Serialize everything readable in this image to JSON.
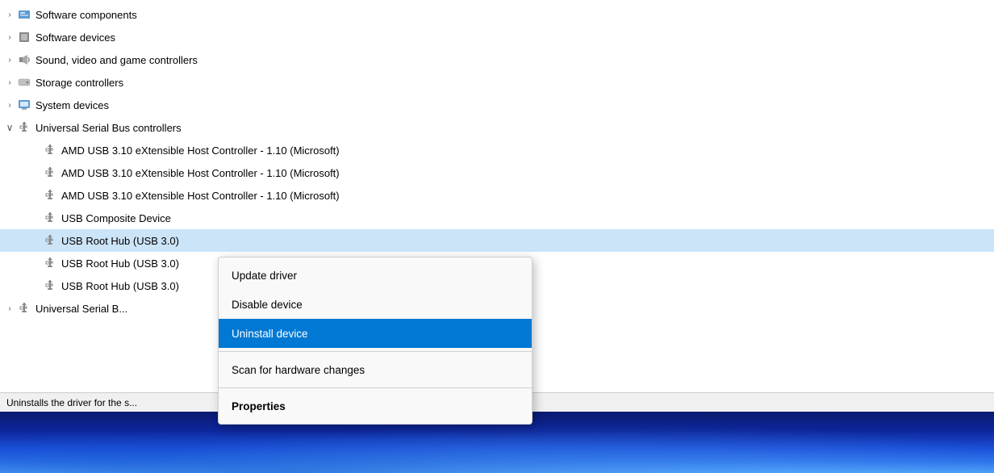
{
  "tree": {
    "items": [
      {
        "id": "software-components",
        "label": "Software components",
        "indent": 1,
        "chevron": "›",
        "iconType": "software-comp",
        "selected": false
      },
      {
        "id": "software-devices",
        "label": "Software devices",
        "indent": 1,
        "chevron": "›",
        "iconType": "software-dev",
        "selected": false
      },
      {
        "id": "sound-video",
        "label": "Sound, video and game controllers",
        "indent": 1,
        "chevron": "›",
        "iconType": "sound",
        "selected": false
      },
      {
        "id": "storage-controllers",
        "label": "Storage controllers",
        "indent": 1,
        "chevron": "›",
        "iconType": "storage",
        "selected": false
      },
      {
        "id": "system-devices",
        "label": "System devices",
        "indent": 1,
        "chevron": "›",
        "iconType": "system",
        "selected": false
      },
      {
        "id": "usb-controllers",
        "label": "Universal Serial Bus controllers",
        "indent": 1,
        "chevron": "∨",
        "iconType": "usb",
        "selected": false,
        "expanded": true
      },
      {
        "id": "amd-usb-1",
        "label": "AMD USB 3.10 eXtensible Host Controller - 1.10 (Microsoft)",
        "indent": 2,
        "chevron": "",
        "iconType": "usb",
        "selected": false
      },
      {
        "id": "amd-usb-2",
        "label": "AMD USB 3.10 eXtensible Host Controller - 1.10 (Microsoft)",
        "indent": 2,
        "chevron": "",
        "iconType": "usb",
        "selected": false
      },
      {
        "id": "amd-usb-3",
        "label": "AMD USB 3.10 eXtensible Host Controller - 1.10 (Microsoft)",
        "indent": 2,
        "chevron": "",
        "iconType": "usb",
        "selected": false
      },
      {
        "id": "usb-composite",
        "label": "USB Composite Device",
        "indent": 2,
        "chevron": "",
        "iconType": "usb",
        "selected": false
      },
      {
        "id": "usb-root-hub-1",
        "label": "USB Root Hub (USB 3.0)",
        "indent": 2,
        "chevron": "",
        "iconType": "usb",
        "selected": true
      },
      {
        "id": "usb-root-hub-2",
        "label": "USB Root Hub (USB 3.0)",
        "indent": 2,
        "chevron": "",
        "iconType": "usb",
        "selected": false
      },
      {
        "id": "usb-root-hub-3",
        "label": "USB Root Hub (USB 3.0)",
        "indent": 2,
        "chevron": "",
        "iconType": "usb",
        "selected": false
      },
      {
        "id": "universal-serial-bus",
        "label": "Universal Serial B...",
        "indent": 1,
        "chevron": "›",
        "iconType": "usb",
        "selected": false
      }
    ]
  },
  "contextMenu": {
    "items": [
      {
        "id": "update-driver",
        "label": "Update driver",
        "bold": false,
        "highlighted": false
      },
      {
        "id": "disable-device",
        "label": "Disable device",
        "bold": false,
        "highlighted": false
      },
      {
        "id": "uninstall-device",
        "label": "Uninstall device",
        "bold": false,
        "highlighted": true
      },
      {
        "id": "scan-hardware",
        "label": "Scan for hardware changes",
        "bold": false,
        "highlighted": false
      },
      {
        "id": "properties",
        "label": "Properties",
        "bold": true,
        "highlighted": false
      }
    ]
  },
  "statusBar": {
    "text": "Uninstalls the driver for the s..."
  }
}
